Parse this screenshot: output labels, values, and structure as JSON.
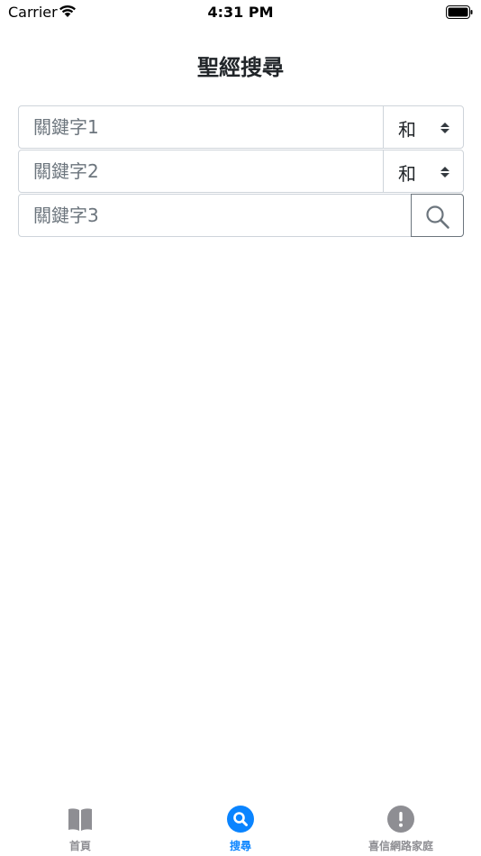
{
  "status_bar": {
    "carrier": "Carrier",
    "time": "4:31 PM"
  },
  "page": {
    "title": "聖經搜尋"
  },
  "search": {
    "keyword1_placeholder": "關鍵字1",
    "keyword2_placeholder": "關鍵字2",
    "keyword3_placeholder": "關鍵字3",
    "operator1": "和",
    "operator2": "和"
  },
  "tab_bar": {
    "tabs": [
      {
        "label": "首頁",
        "icon": "book-icon",
        "active": false
      },
      {
        "label": "搜尋",
        "icon": "search-icon",
        "active": true
      },
      {
        "label": "喜信網路家庭",
        "icon": "exclamation-icon",
        "active": false
      }
    ]
  },
  "colors": {
    "accent": "#0a84ff",
    "inactive": "#8e8e93",
    "border": "#ced4da",
    "button_border": "#6c757d"
  }
}
